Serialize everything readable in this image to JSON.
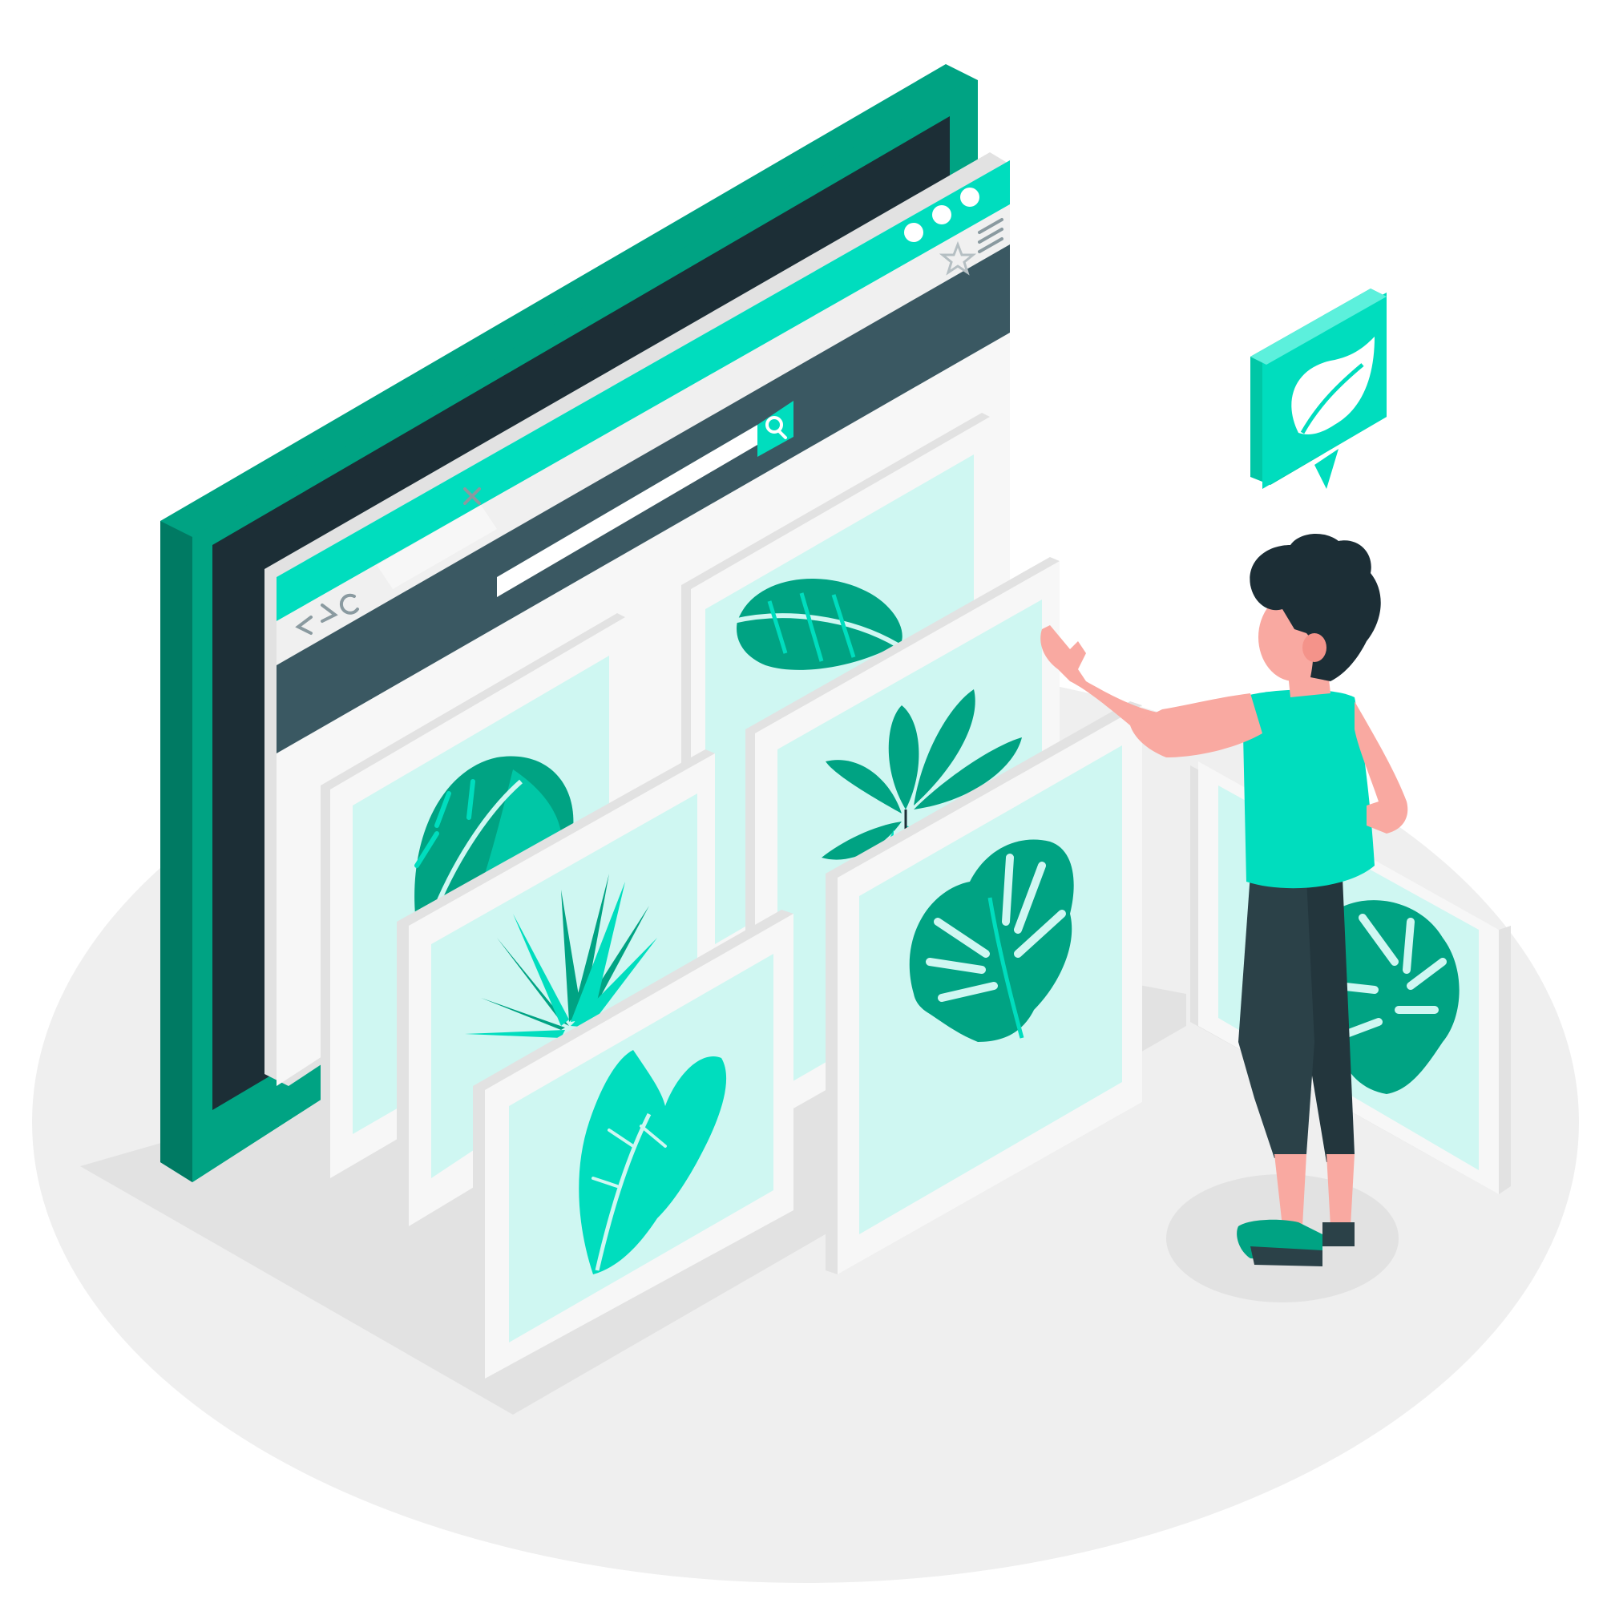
{
  "palette": {
    "accent": "#00DDBE",
    "accent_dark": "#00A383",
    "accent_deep": "#007A63",
    "panel_light": "#CFF7F2",
    "frame_white": "#F7F7F7",
    "frame_edge": "#E2E2E2",
    "screen_dark": "#1C2E36",
    "toolbar_slate": "#3A5862",
    "ground": "#EFEFEF",
    "ground_shadow": "#E3E3E3",
    "skin": "#F9A9A1",
    "pants": "#2B4148"
  },
  "browser": {
    "nav_icons": [
      "back-arrow-icon",
      "forward-arrow-icon",
      "reload-icon"
    ],
    "tab_close_icon": "close-icon",
    "window_controls": [
      "window-dot-icon",
      "window-dot-icon",
      "window-dot-icon"
    ],
    "bookmark_icon": "star-icon",
    "menu_icon": "hamburger-menu-icon",
    "search_icon": "search-icon"
  },
  "gallery": {
    "tiles": [
      {
        "icon": "round-leaf-icon"
      },
      {
        "icon": "striped-leaf-icon"
      },
      {
        "icon": "palm-leaf-icon"
      },
      {
        "icon": "heart-leaf-icon"
      },
      {
        "icon": "schefflera-leaf-icon"
      },
      {
        "icon": "monstera-leaf-icon"
      },
      {
        "icon": "monstera-leaf-icon"
      }
    ]
  },
  "badge": {
    "icon": "leaf-icon"
  }
}
